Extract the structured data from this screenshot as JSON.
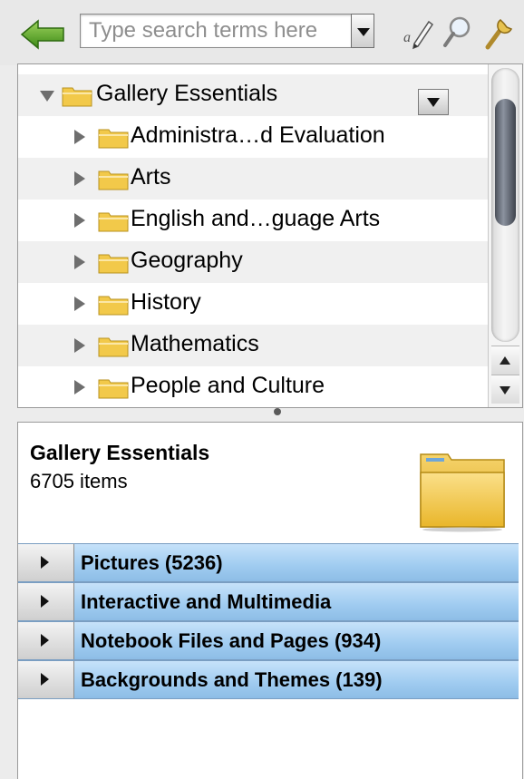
{
  "toolbar": {
    "search_placeholder": "Type search terms here",
    "icons": [
      "back-arrow-icon",
      "search-dropdown-icon",
      "properties-pencil-icon",
      "search-magnifier-icon",
      "wrench-icon"
    ]
  },
  "tree": {
    "items": [
      {
        "label": "Gallery Essentials",
        "expanded": true
      },
      {
        "label": "Administra…d Evaluation",
        "expanded": false
      },
      {
        "label": "Arts",
        "expanded": false
      },
      {
        "label": "English and…guage Arts",
        "expanded": false
      },
      {
        "label": "Geography",
        "expanded": false
      },
      {
        "label": "History",
        "expanded": false
      },
      {
        "label": "Mathematics",
        "expanded": false
      },
      {
        "label": "People and Culture",
        "expanded": false
      }
    ]
  },
  "info": {
    "title": "Gallery Essentials",
    "count": "6705 items"
  },
  "categories": [
    {
      "label": "Pictures (5236)"
    },
    {
      "label": "Interactive and Multimedia"
    },
    {
      "label": "Notebook Files and Pages (934)"
    },
    {
      "label": "Backgrounds and Themes (139)"
    }
  ],
  "colors": {
    "accent_green": "#3c8a16",
    "folder_yellow": "#f2c94a",
    "category_blue": "#a6cff2"
  }
}
